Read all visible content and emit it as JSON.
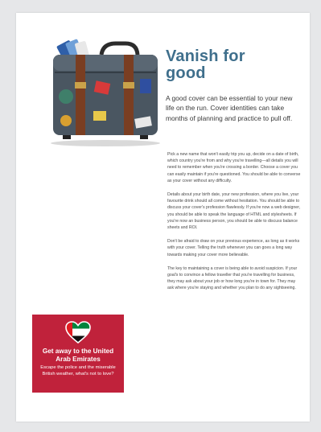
{
  "article": {
    "title": "Vanish for good",
    "lede": "A good cover can be essential to your new life on the run. Cover identities can take months of planning and practice to pull off.",
    "paragraphs": [
      "Pick a new name that won't easily trip you up, decide on a date of birth, which country you're from and why you're travelling—all details you will need to remember when you're crossing a border. Choose a cover you can easily maintain if you're questioned. You should be able to converse as your cover without any difficulty.",
      "Details about your birth date, your new profession, where you live, your favourite drink should all come without hesitation. You should be able to discuss your cover's profession flawlessly. If you're now a web designer, you should be able to speak the language of HTML and stylesheets. If you're now an business person, you should be able to discuss balance sheets and ROI.",
      "Don't be afraid to draw on your previous experience, as long as it works with your cover. Telling the truth whenever you can goes a long way towards making your cover more believable.",
      "The key to maintaining a cover is being able to avoid suspicion. If your goal's to convince a fellow traveller that you're travelling for business, they may ask about your job or how long you're in town for. They may ask where you're staying and whether you plan to do any sightseeing."
    ]
  },
  "promo": {
    "title": "Get away to the United Arab Emirates",
    "subtitle": "Escape the police and the miserable British weather, what's not to love?",
    "icon": "uae-flag-heart-icon"
  },
  "colors": {
    "title": "#3f6f8c",
    "promo_bg": "#c0223b",
    "suitcase": "#4a5661",
    "strap": "#7a3e22"
  }
}
